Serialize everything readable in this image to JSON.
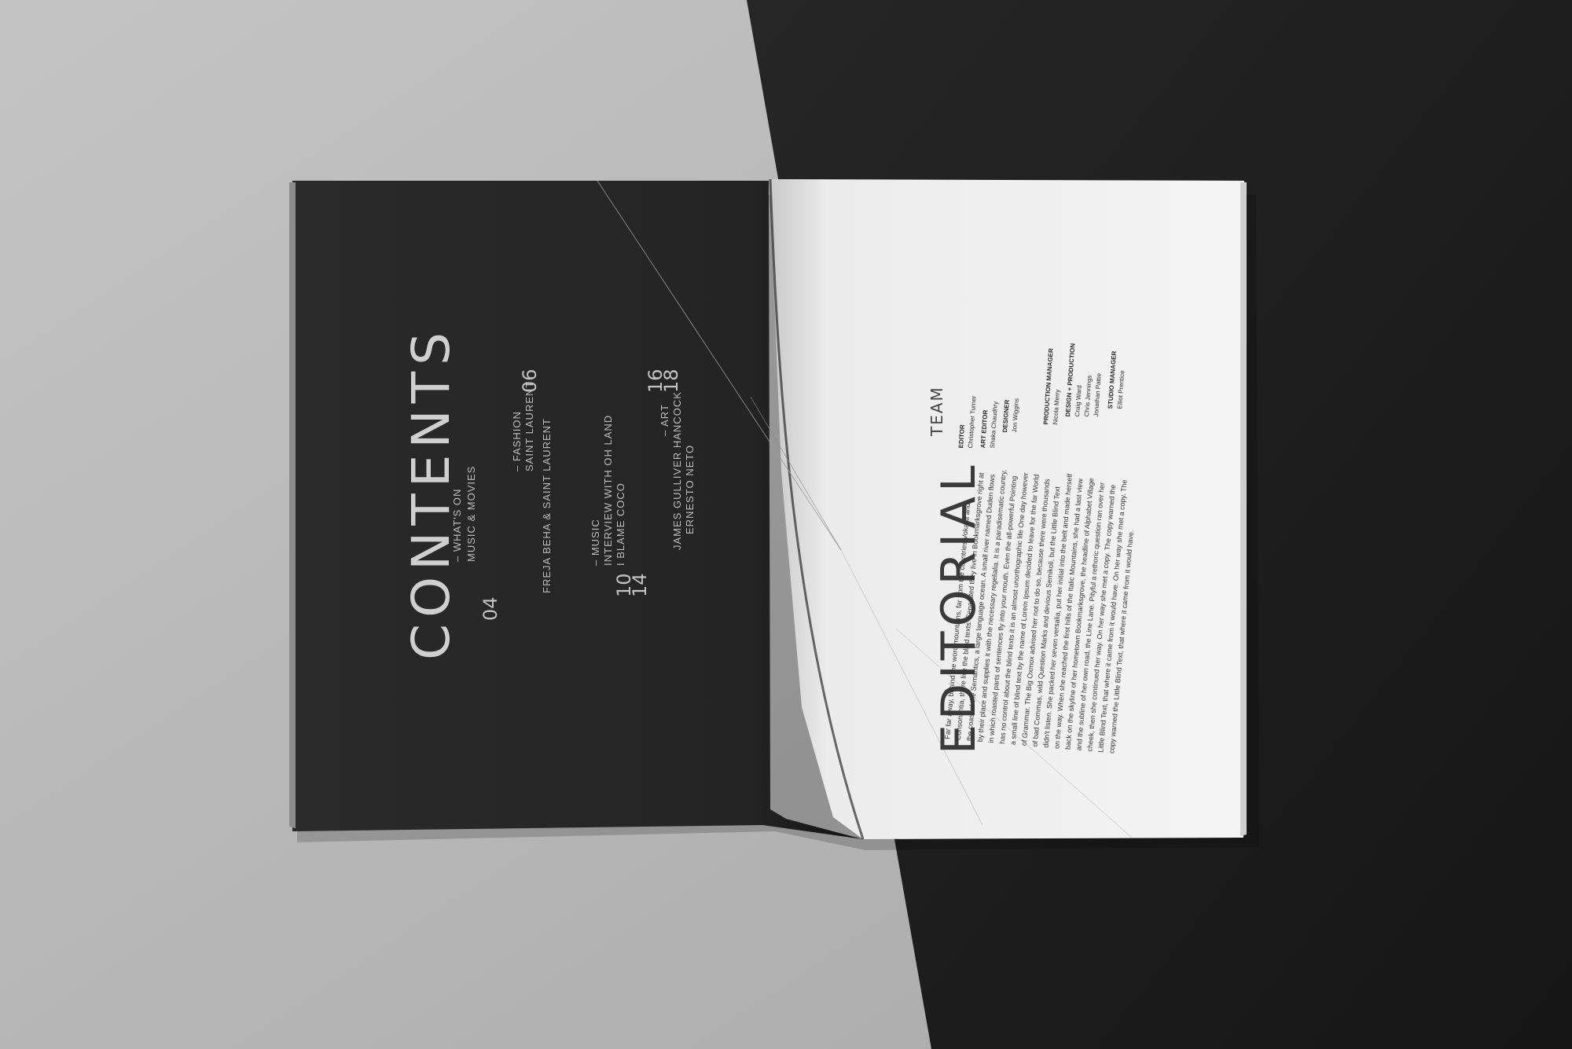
{
  "colors": {
    "surface_left": "#b9b9b9",
    "surface_right": "#1f1f1f",
    "page_dark": "#262626",
    "page_light": "#efefef",
    "ink_light": "#c8c8c8",
    "ink_dark": "#2b2b2b"
  },
  "contents": {
    "title": "CONTENTS",
    "entries": [
      {
        "numbers": [
          "04"
        ],
        "lines": [
          "– WHAT'S ON",
          "MUSIC & MOVIES"
        ]
      },
      {
        "numbers": [
          "06"
        ],
        "lines": [
          "– FASHION",
          "SAINT LAURENT"
        ]
      },
      {
        "numbers": [],
        "lines": [
          "FREJA BEHA & SAINT LAURENT"
        ]
      },
      {
        "numbers": [
          "10",
          "14"
        ],
        "lines": [
          "– MUSIC",
          "INTERVIEW WITH OH LAND",
          "I BLAME COCO"
        ]
      },
      {
        "numbers": [
          "16",
          "18"
        ],
        "lines": [
          "– ART",
          "JAMES GULLIVER HANCOCK",
          "ERNESTO NETO"
        ]
      }
    ]
  },
  "editorial": {
    "title": "EDITORIAL",
    "body": "Far far away, behind the word mountains, far from the countries Vokalia and Consonantia, there live the blind texts. Separated they live in Bookmarksgrove right at the coast of the Semantics, a large language ocean. A small river named Duden flows by their place and supplies it with the necessary regelialia. It is a paradisematic country, in which roasted parts of sentences fly into your mouth. Even the all-powerful Pointing has no control about the blind texts it is an almost unorthographic life One day however a small line of blind text by the name of Lorem Ipsum decided to leave for the far World of Grammar. The Big Oxmox advised her not to do so, because there were thousands of bad Commas, wild Question Marks and devious Semikoli, but the Little Blind Text didn't listen. She packed her seven versalia, put her initial into the belt and made herself on the way. When she reached the first hills of the Italic Mountains, she had a last view back on the skyline of her hometown Bookmarksgrove, the headline of Alphabet Village and the subline of her own road, the Line Lane. Pityful a rethoric question ran over her cheek, then she continued her way. On her way she met a copy. The copy warned the Little Blind Text, that where it came from it would have. On her way she met a copy. The copy warned the Little Blind Text, that where it came from it would have.",
    "team_heading": "TEAM",
    "team": [
      {
        "role": "EDITOR",
        "names": [
          "Christopher Turner"
        ]
      },
      {
        "role": "ART EDITOR",
        "names": [
          "Shaka Chaudhry"
        ]
      },
      {
        "role": "DESIGNER",
        "names": [
          "Jon Wiggins"
        ]
      },
      {
        "role": "PRODUCTION MANAGER",
        "names": [
          "Nicola Merry"
        ]
      },
      {
        "role": "DESIGN + PRODUCTION",
        "names": [
          "Craig Ward",
          "Chris Jennings",
          "Jonathan Pattie"
        ]
      },
      {
        "role": "STUDIO MANAGER",
        "names": [
          "Elliot Prentice"
        ]
      }
    ]
  }
}
